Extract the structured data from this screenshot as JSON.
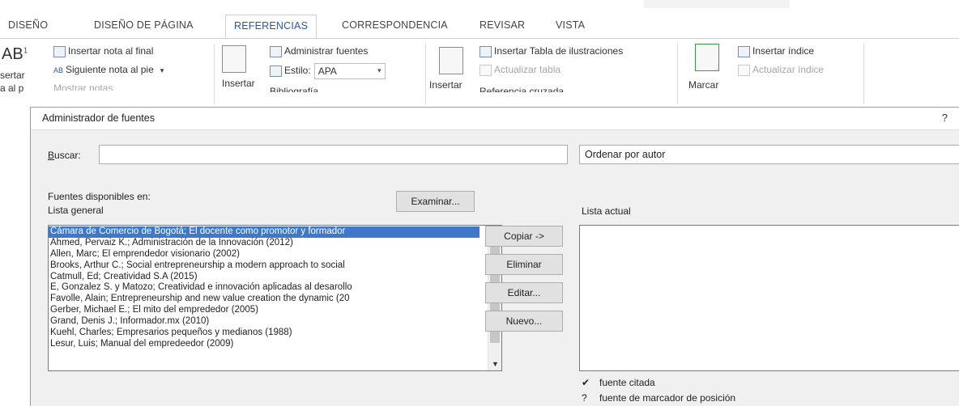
{
  "ribbon_tabs": [
    "DISEÑO",
    "DISEÑO DE PÁGINA",
    "REFERENCIAS",
    "CORRESPONDENCIA",
    "REVISAR",
    "VISTA"
  ],
  "ribbon": {
    "footnote_big": "AB",
    "footnote_super": "1",
    "footnote_cut1": "sertar",
    "footnote_cut2": "a al p",
    "insert_endnote": "Insertar nota al final",
    "next_footnote": "Siguiente nota al pie",
    "show_notes_cut": "Mostrar notas",
    "insert_citation": "Insertar",
    "manage_sources": "Administrar fuentes",
    "style_label": "Estilo:",
    "style_value": "APA",
    "bibliography_cut": "Bibliografía",
    "insert_caption": "Insertar",
    "insert_table_figures": "Insertar Tabla de ilustraciones",
    "update_table": "Actualizar tabla",
    "cross_reference_cut": "Referencia cruzada",
    "mark_entry": "Marcar",
    "insert_index": "Insertar índice",
    "update_index": "Actualizar índice"
  },
  "dialog": {
    "title": "Administrador de fuentes",
    "help": "?",
    "search_label_first": "B",
    "search_label_rest": "uscar:",
    "search_value": "",
    "sort_value": "Ordenar por autor",
    "available_in": "Fuentes disponibles en:",
    "master_list": "Lista general",
    "browse_button": "Examinar...",
    "current_list": "Lista actual",
    "copy_button": "Copiar ->",
    "delete_button": "Eliminar",
    "edit_button": "Editar...",
    "new_button": "Nuevo...",
    "sources": [
      "Cámara de Comercio de Bogotá; El docente como promotor y formador",
      "Ahmed, Pervaiz K.; Administración de la Innovación (2012)",
      "Allen, Marc; El emprendedor visionario  (2002)",
      "Brooks, Arthur C.; Social entrepreneurship a modern approach to social",
      "Catmull, Ed; Creatividad S.A (2015)",
      "E, Gonzalez S. y Matozo; Creatividad e innovación aplicadas al desarollo",
      "Favolle, Alain; Entrepreneurship and new value creation the dynamic (20",
      "Gerber, Michael E.; El mito del emprededor  (2005)",
      "Grand, Denis J.; Informador.mx (2010)",
      "Kuehl, Charles; Empresarios pequeños y medianos  (1988)",
      "Lesur, Luis; Manual del empredeedor  (2009)"
    ],
    "selected_index": 0,
    "legend_cited_symbol": "✔",
    "legend_cited": "fuente citada",
    "legend_placeholder_symbol": "?",
    "legend_placeholder": "fuente de marcador de posición"
  }
}
